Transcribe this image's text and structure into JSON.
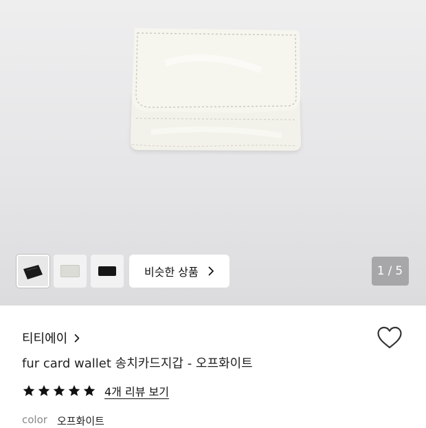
{
  "gallery": {
    "counter_current": "1",
    "counter_separator": "/",
    "counter_total": "5",
    "similar_button_label": "비슷한 상품",
    "thumbnails": [
      {
        "icon": "black-wallet-thumbnail",
        "selected": true
      },
      {
        "icon": "offwhite-wallet-thumbnail",
        "selected": false
      },
      {
        "icon": "black-wallet-flat-thumbnail",
        "selected": false
      }
    ]
  },
  "product": {
    "brand": "티티에이",
    "title": "fur card wallet 송치카드지갑 - 오프화이트",
    "rating_stars": 5,
    "review_link": "4개 리뷰 보기",
    "color_label": "color",
    "color_value": "오프화이트"
  },
  "colors": {
    "wallet": "#f3f2ea",
    "stitch": "#c9c7bd",
    "counter_bg": "#8a8a8e",
    "star": "#111111"
  }
}
